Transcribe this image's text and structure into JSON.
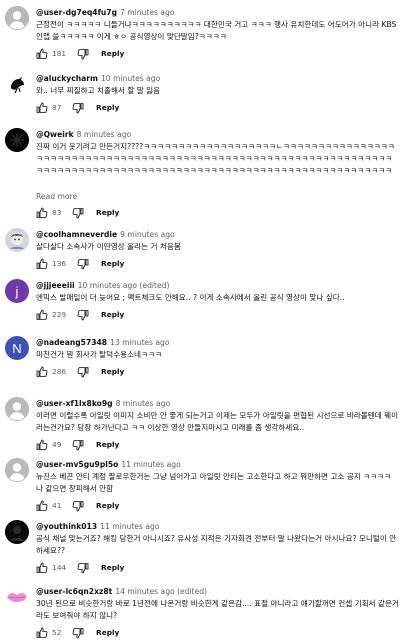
{
  "comments": [
    {
      "handle": "@user-dg7eq4fu7g",
      "time": "7 minutes ago",
      "text": "근정전이 ㅋㅋㅋㅋㅋ 니들거냐ㅋㅋㅋㅋㅋㅋㅋㅋㅋㅋ 대한민국 거고 ㅋㅋㅋ 행사 유치한데도 어도어가 아니라 KBS 인맵 쓸ㅋㅋㅋㅋㅋ 이게 ㅎㅇ 공식영상이 맞단말임?ㅋㅋㅋㅋ",
      "likes": "181",
      "reply": "Reply",
      "avatar_color": "#aaaaaa",
      "avatar_icon": "default-person-icon"
    },
    {
      "handle": "@aluckycharm",
      "time": "10 minutes ago",
      "text": "와.. 너무 찌질하고 치졸해서 할 말 잃음",
      "likes": "87",
      "reply": "Reply",
      "avatar_color": "#ffffff",
      "avatar_icon": "bird-icon"
    },
    {
      "handle": "@Qweirk",
      "time": "8 minutes ago",
      "text": "진짜 이거 웃기려고 만든거지????ㅋㅋㅋㅋㅋㅋㅋㅋㅋㅋㅋㅋㅋㅋㅋㅋㅋㅋㅋㄴㅋㅋㅋㅋㅋㅋㅋㅋㅋㅋㅋㅋㅋㅋㅋㅋㅋㅋㅋㅋㅋㅋㅋㅋㅋㅋㅋㅋㅋㅋㅋㅋㅋㅋㅋㅋㅋㅋㅋㅋㅋㅋㅋㅋㅋㅋㅋㅋㅋㅋㅋㅋㅋㅋㅋㅋㅋㅋㅋㅋㅋㅋㅋㅋㅋㅋㅋㅋㅋㅋㅋㅋㅋㅋㅋㅋㅋㅋㅋㅋㅋㅋㅋㅋㅋㅋㅋㅋㅋㅋㅋㅋㅋㅋㅋㅋㅋㅋㅋㅋㅋㅋㅋㅋㅋㅋㅋㅋㅋㅋㅋㅋㅋㅋㅋㅋㅋㅋ",
      "read_more": "Read more",
      "likes": "83",
      "reply": "Reply",
      "avatar_color": "#000000",
      "avatar_icon": "dark-pattern-icon"
    },
    {
      "handle": "@coolhamneverdie",
      "time": "9 minutes ago",
      "text": "살다살다 소속사가 이딴영상 올리는 거 처음봄",
      "likes": "136",
      "reply": "Reply",
      "avatar_color": "#d8dde6",
      "avatar_icon": "character-icon"
    },
    {
      "handle": "@jjjeeeiii",
      "time": "10 minutes ago (edited)",
      "text": "엔믹스 발매일이 더 늦어요 ; 팩트체크도 안해요.. ? 이게 소속사에서 올린 공식 영상이 맞나 싶다..",
      "likes": "229",
      "reply": "Reply",
      "avatar_color": "#6f3aa8",
      "avatar_letter": "j"
    },
    {
      "handle": "@nadeang57348",
      "time": "13 minutes ago",
      "text": "미친건가 뭔 회사가 탈덕수용소네ㅋㅋㅋ",
      "likes": "286",
      "reply": "Reply",
      "avatar_color": "#3f51b5",
      "avatar_letter": "N"
    },
    {
      "handle": "@user-xf1lx8ko9g",
      "time": "8 minutes ago",
      "text": "이러면 이럴수록 아일릿 이미지 소비만 안 좋게 되는거고 이제는 모두가 아일릿을 편협된 시선으로 바라볼텐데 웨이러는건가요? 당장 하가난다고 ㅋㅋ 이상한 영상 만들지마시고 미래를 좀 생각하세요..",
      "likes": "49",
      "reply": "Reply",
      "avatar_color": "#aaaaaa",
      "avatar_icon": "default-person-icon"
    },
    {
      "handle": "@user-mv5gu9pl5o",
      "time": "11 minutes ago",
      "text": "뉴진스 베끈 안티 계정 팔로우한거는 그냥 넘어가고 아일릿 안티는 고소한다고 하고 뭐만하면 고소 공지 ㅋㅋㅋㅋ 나 같으면 창피해서 안함",
      "likes": "41",
      "reply": "Reply",
      "avatar_color": "#aaaaaa",
      "avatar_icon": "default-person-icon"
    },
    {
      "handle": "@youthink013",
      "time": "11 minutes ago",
      "text": "공식 채널 맞는거죠? 해킹 당한거 아니시죠? 유사성 지적은 기자회견 전부터 말 나왔다는거 아시나요? 모니털이 안하세요??",
      "likes": "144",
      "reply": "Reply",
      "avatar_color": "#000000",
      "avatar_icon": "dark-silhouette-icon"
    },
    {
      "handle": "@user-lc6qn2xz8t",
      "time": "14 minutes ago (edited)",
      "text": "30년 된으로 비슷한거랑 바로 1년전에 나온거랑 비슷한게 같은감.... 표절 아니라고 얘기할꺼면 컨셉 기획서 같은거라도 보여줘야 하지 않니?",
      "likes": "52",
      "reply": "Reply",
      "avatar_color": "#ffffff",
      "avatar_icon": "pink-lips-icon"
    }
  ]
}
